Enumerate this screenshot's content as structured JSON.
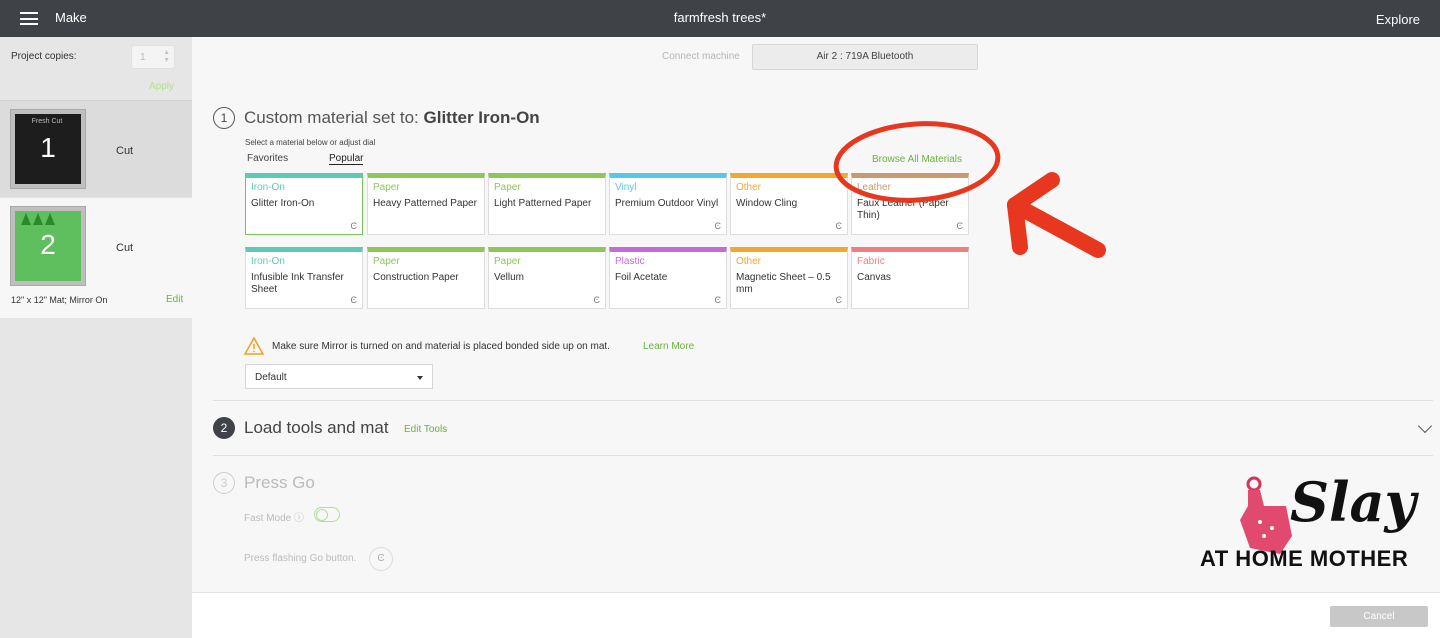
{
  "header": {
    "menu_label": "Make",
    "project_title": "farmfresh trees*",
    "explore_label": "Explore"
  },
  "sidebar": {
    "copies_label": "Project copies:",
    "copies_value": "1",
    "apply_label": "Apply",
    "mats": [
      {
        "number": "1",
        "action": "Cut",
        "caption": "Fresh Cut"
      },
      {
        "number": "2",
        "action": "Cut"
      }
    ],
    "mat_size": "12\" x 12\" Mat; Mirror On",
    "edit_label": "Edit"
  },
  "connect": {
    "label": "Connect machine",
    "machine": "Air 2 : 719A Bluetooth"
  },
  "step1": {
    "number": "1",
    "prefix": "Custom material set to: ",
    "material": "Glitter Iron-On",
    "hint": "Select a material below or adjust dial",
    "tab_favorites": "Favorites",
    "tab_popular": "Popular",
    "browse_all": "Browse All Materials",
    "materials": [
      {
        "category": "Iron-On",
        "name": "Glitter Iron-On",
        "color": "#5fc9b5",
        "dial": "Ͼ"
      },
      {
        "category": "Paper",
        "name": "Heavy Patterned Paper",
        "color": "#8fc65a",
        "dial": ""
      },
      {
        "category": "Paper",
        "name": "Light Patterned Paper",
        "color": "#8fc65a",
        "dial": ""
      },
      {
        "category": "Vinyl",
        "name": "Premium Outdoor Vinyl",
        "color": "#5bc5e8",
        "dial": "Ͼ"
      },
      {
        "category": "Other",
        "name": "Window Cling",
        "color": "#f0a830",
        "dial": "Ͼ"
      },
      {
        "category": "Leather",
        "name": "Faux Leather (Paper Thin)",
        "color": "#c79a72",
        "dial": "Ͼ"
      },
      {
        "category": "Iron-On",
        "name": "Infusible Ink Transfer Sheet",
        "color": "#5fc9b5",
        "dial": "Ͼ"
      },
      {
        "category": "Paper",
        "name": "Construction Paper",
        "color": "#8fc65a",
        "dial": ""
      },
      {
        "category": "Paper",
        "name": "Vellum",
        "color": "#8fc65a",
        "dial": "Ͼ"
      },
      {
        "category": "Plastic",
        "name": "Foil Acetate",
        "color": "#c56bd8",
        "dial": "Ͼ"
      },
      {
        "category": "Other",
        "name": "Magnetic Sheet – 0.5 mm",
        "color": "#f0a830",
        "dial": "Ͼ"
      },
      {
        "category": "Fabric",
        "name": "Canvas",
        "color": "#ef7f7f",
        "dial": ""
      }
    ],
    "warning": "Make sure Mirror is turned on and material is placed bonded side up on mat.",
    "learn_more": "Learn More",
    "pressure": "Default"
  },
  "step2": {
    "number": "2",
    "title": "Load tools and mat",
    "edit_tools": "Edit Tools"
  },
  "step3": {
    "number": "3",
    "title": "Press Go",
    "fast_mode": "Fast Mode",
    "press_go_hint": "Press flashing Go button."
  },
  "footer": {
    "cancel_label": "Cancel"
  },
  "colors": {
    "accent_green": "#69b33c",
    "annotation_red": "#e8371f",
    "topbar": "#3f4247"
  },
  "watermark": {
    "slay": "Slay",
    "subtitle": "AT HOME MOTHER"
  }
}
